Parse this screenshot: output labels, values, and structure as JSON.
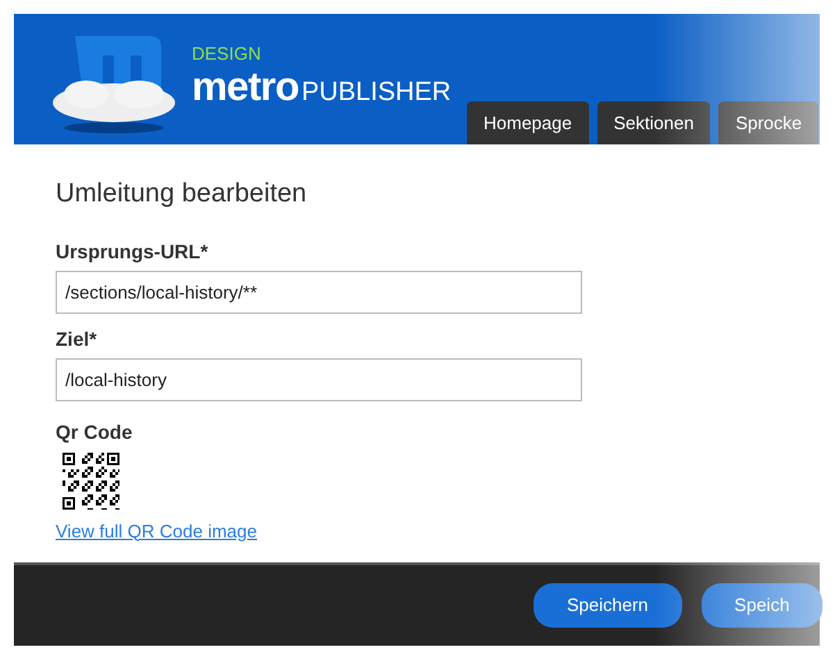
{
  "header": {
    "brand_top": "DESIGN",
    "brand_bold": "metro",
    "brand_rest": "PUBLISHER"
  },
  "tabs": [
    {
      "label": "Homepage"
    },
    {
      "label": "Sektionen"
    },
    {
      "label": "Sprocke"
    }
  ],
  "form": {
    "title": "Umleitung bearbeiten",
    "fields": [
      {
        "label": "Ursprungs-URL*",
        "value": "/sections/local-history/**"
      },
      {
        "label": "Ziel*",
        "value": "/local-history"
      }
    ],
    "qr": {
      "label": "Qr Code",
      "link": "View full QR Code image"
    }
  },
  "footer": {
    "buttons": [
      "Speichern",
      "Speich"
    ]
  }
}
